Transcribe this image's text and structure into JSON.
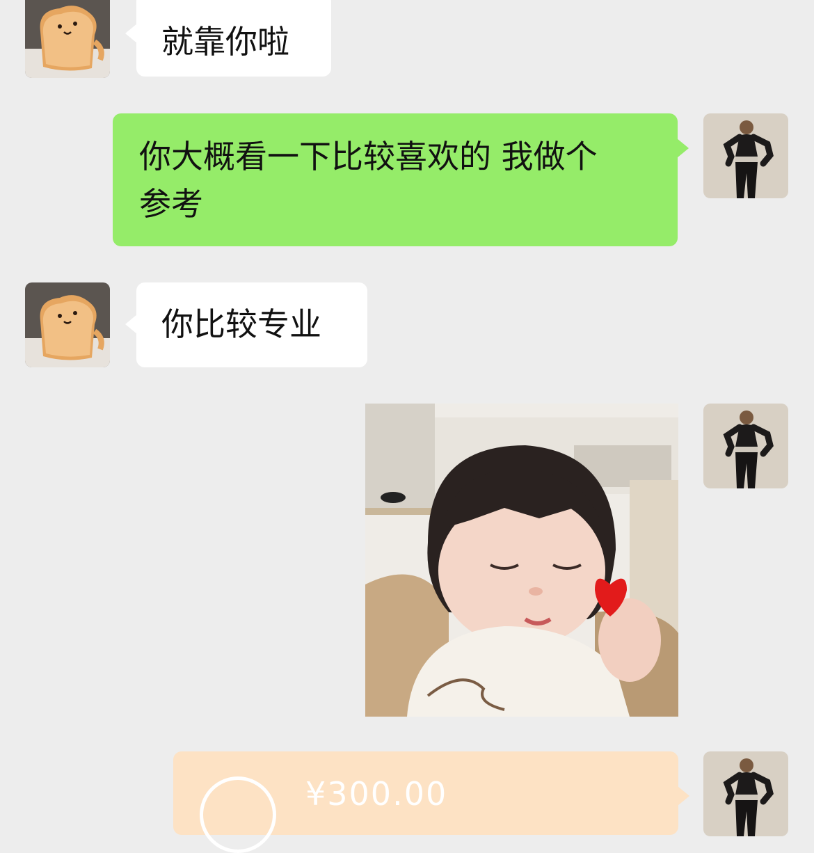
{
  "messages": [
    {
      "side": "incoming",
      "type": "text",
      "text": "就靠你啦"
    },
    {
      "side": "outgoing",
      "type": "text",
      "lines": [
        "你大概看一下比较喜欢的 我做个",
        "参考"
      ]
    },
    {
      "side": "incoming",
      "type": "text",
      "text": "你比较专业"
    },
    {
      "side": "outgoing",
      "type": "image"
    },
    {
      "side": "outgoing",
      "type": "transfer",
      "amount": "¥300.00"
    }
  ],
  "colors": {
    "background": "#ededed",
    "incoming_bubble": "#ffffff",
    "outgoing_bubble": "#95ec69",
    "transfer_card": "#fde2c4"
  },
  "icons": {
    "incoming_avatar": "toast-avatar",
    "outgoing_avatar": "woman-avatar",
    "transfer": "transfer-arrow-icon"
  }
}
